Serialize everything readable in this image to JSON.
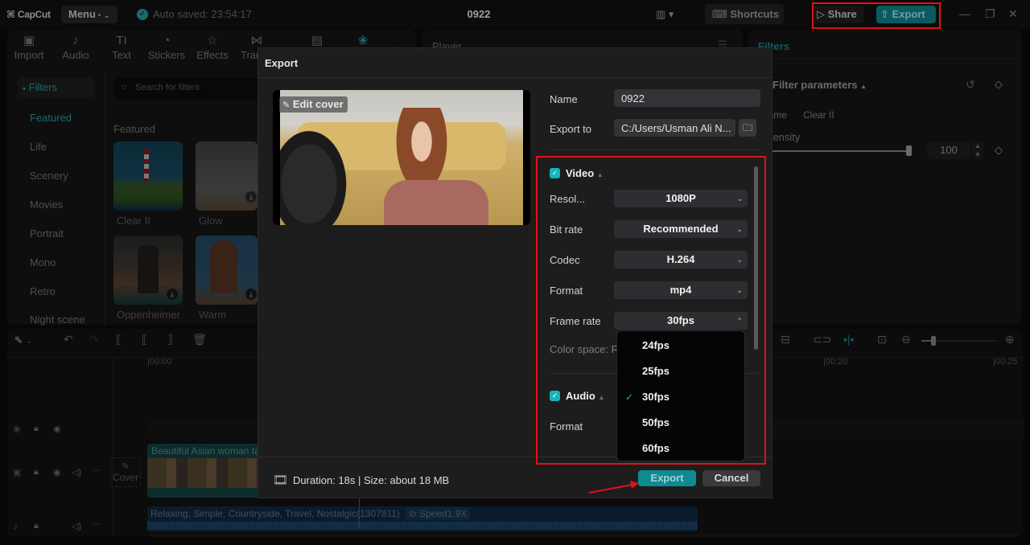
{
  "app": {
    "logo": "CapCut",
    "menu_label": "Menu",
    "autosave": "Auto saved: 23:54:17",
    "project_title": "0922",
    "shortcuts_label": "Shortcuts",
    "share_label": "Share",
    "export_label": "Export"
  },
  "toolbar": {
    "items": [
      {
        "label": "Import",
        "icon": "import-icon"
      },
      {
        "label": "Audio",
        "icon": "audio-icon"
      },
      {
        "label": "Text",
        "icon": "text-icon"
      },
      {
        "label": "Stickers",
        "icon": "stickers-icon"
      },
      {
        "label": "Effects",
        "icon": "effects-icon"
      },
      {
        "label": "Trans",
        "icon": "transitions-icon"
      },
      {
        "label": "",
        "icon": "captions-icon"
      },
      {
        "label": "",
        "icon": "filters-icon"
      }
    ]
  },
  "filters_sidebar": {
    "header": "Filters",
    "items": [
      "Featured",
      "Life",
      "Scenery",
      "Movies",
      "Portrait",
      "Mono",
      "Retro",
      "Night scene"
    ],
    "active": "Featured"
  },
  "filters_grid": {
    "search_placeholder": "Search for filters",
    "section": "Featured",
    "items": [
      {
        "name": "Clear II"
      },
      {
        "name": "Glow"
      },
      {
        "name": "Oppenheimer"
      },
      {
        "name": "Warm"
      }
    ]
  },
  "player": {
    "title": "Player"
  },
  "right_panel": {
    "tab": "Filters",
    "section": "Filter parameters",
    "name_label": "Name",
    "name_value": "Clear II",
    "intensity_label": "Intensity",
    "intensity_value": "100",
    "intensity_fraction": 1.0
  },
  "timeline": {
    "ruler": [
      "00:00",
      "00:20",
      "00:25"
    ],
    "cover_label": "Cover",
    "video_clip": "Beautiful Asian woman ta",
    "audio_clip": "Relaxing, Simple, Countryside, Travel, Nostalgic(1307811)",
    "audio_speed": "Speed1.9X"
  },
  "export_dialog": {
    "title": "Export",
    "edit_cover": "Edit cover",
    "name_label": "Name",
    "name_value": "0922",
    "export_to_label": "Export to",
    "export_to_value": "C:/Users/Usman Ali N...",
    "video": {
      "title": "Video",
      "checked": true,
      "resolution_label": "Resol...",
      "resolution_value": "1080P",
      "bitrate_label": "Bit rate",
      "bitrate_value": "Recommended",
      "codec_label": "Codec",
      "codec_value": "H.264",
      "format_label": "Format",
      "format_value": "mp4",
      "framerate_label": "Frame rate",
      "framerate_value": "30fps",
      "colorspace_label": "Color space: R"
    },
    "audio": {
      "title": "Audio",
      "checked": true,
      "format_label": "Format"
    },
    "framerate_options": [
      "24fps",
      "25fps",
      "30fps",
      "50fps",
      "60fps"
    ],
    "framerate_selected": "30fps",
    "duration_info": "Duration: 18s | Size: about 18 MB",
    "export_button": "Export",
    "cancel_button": "Cancel"
  },
  "colors": {
    "accent": "#16b3bb",
    "highlight": "#e0121a",
    "dialog_bg": "#1d1d1d"
  }
}
